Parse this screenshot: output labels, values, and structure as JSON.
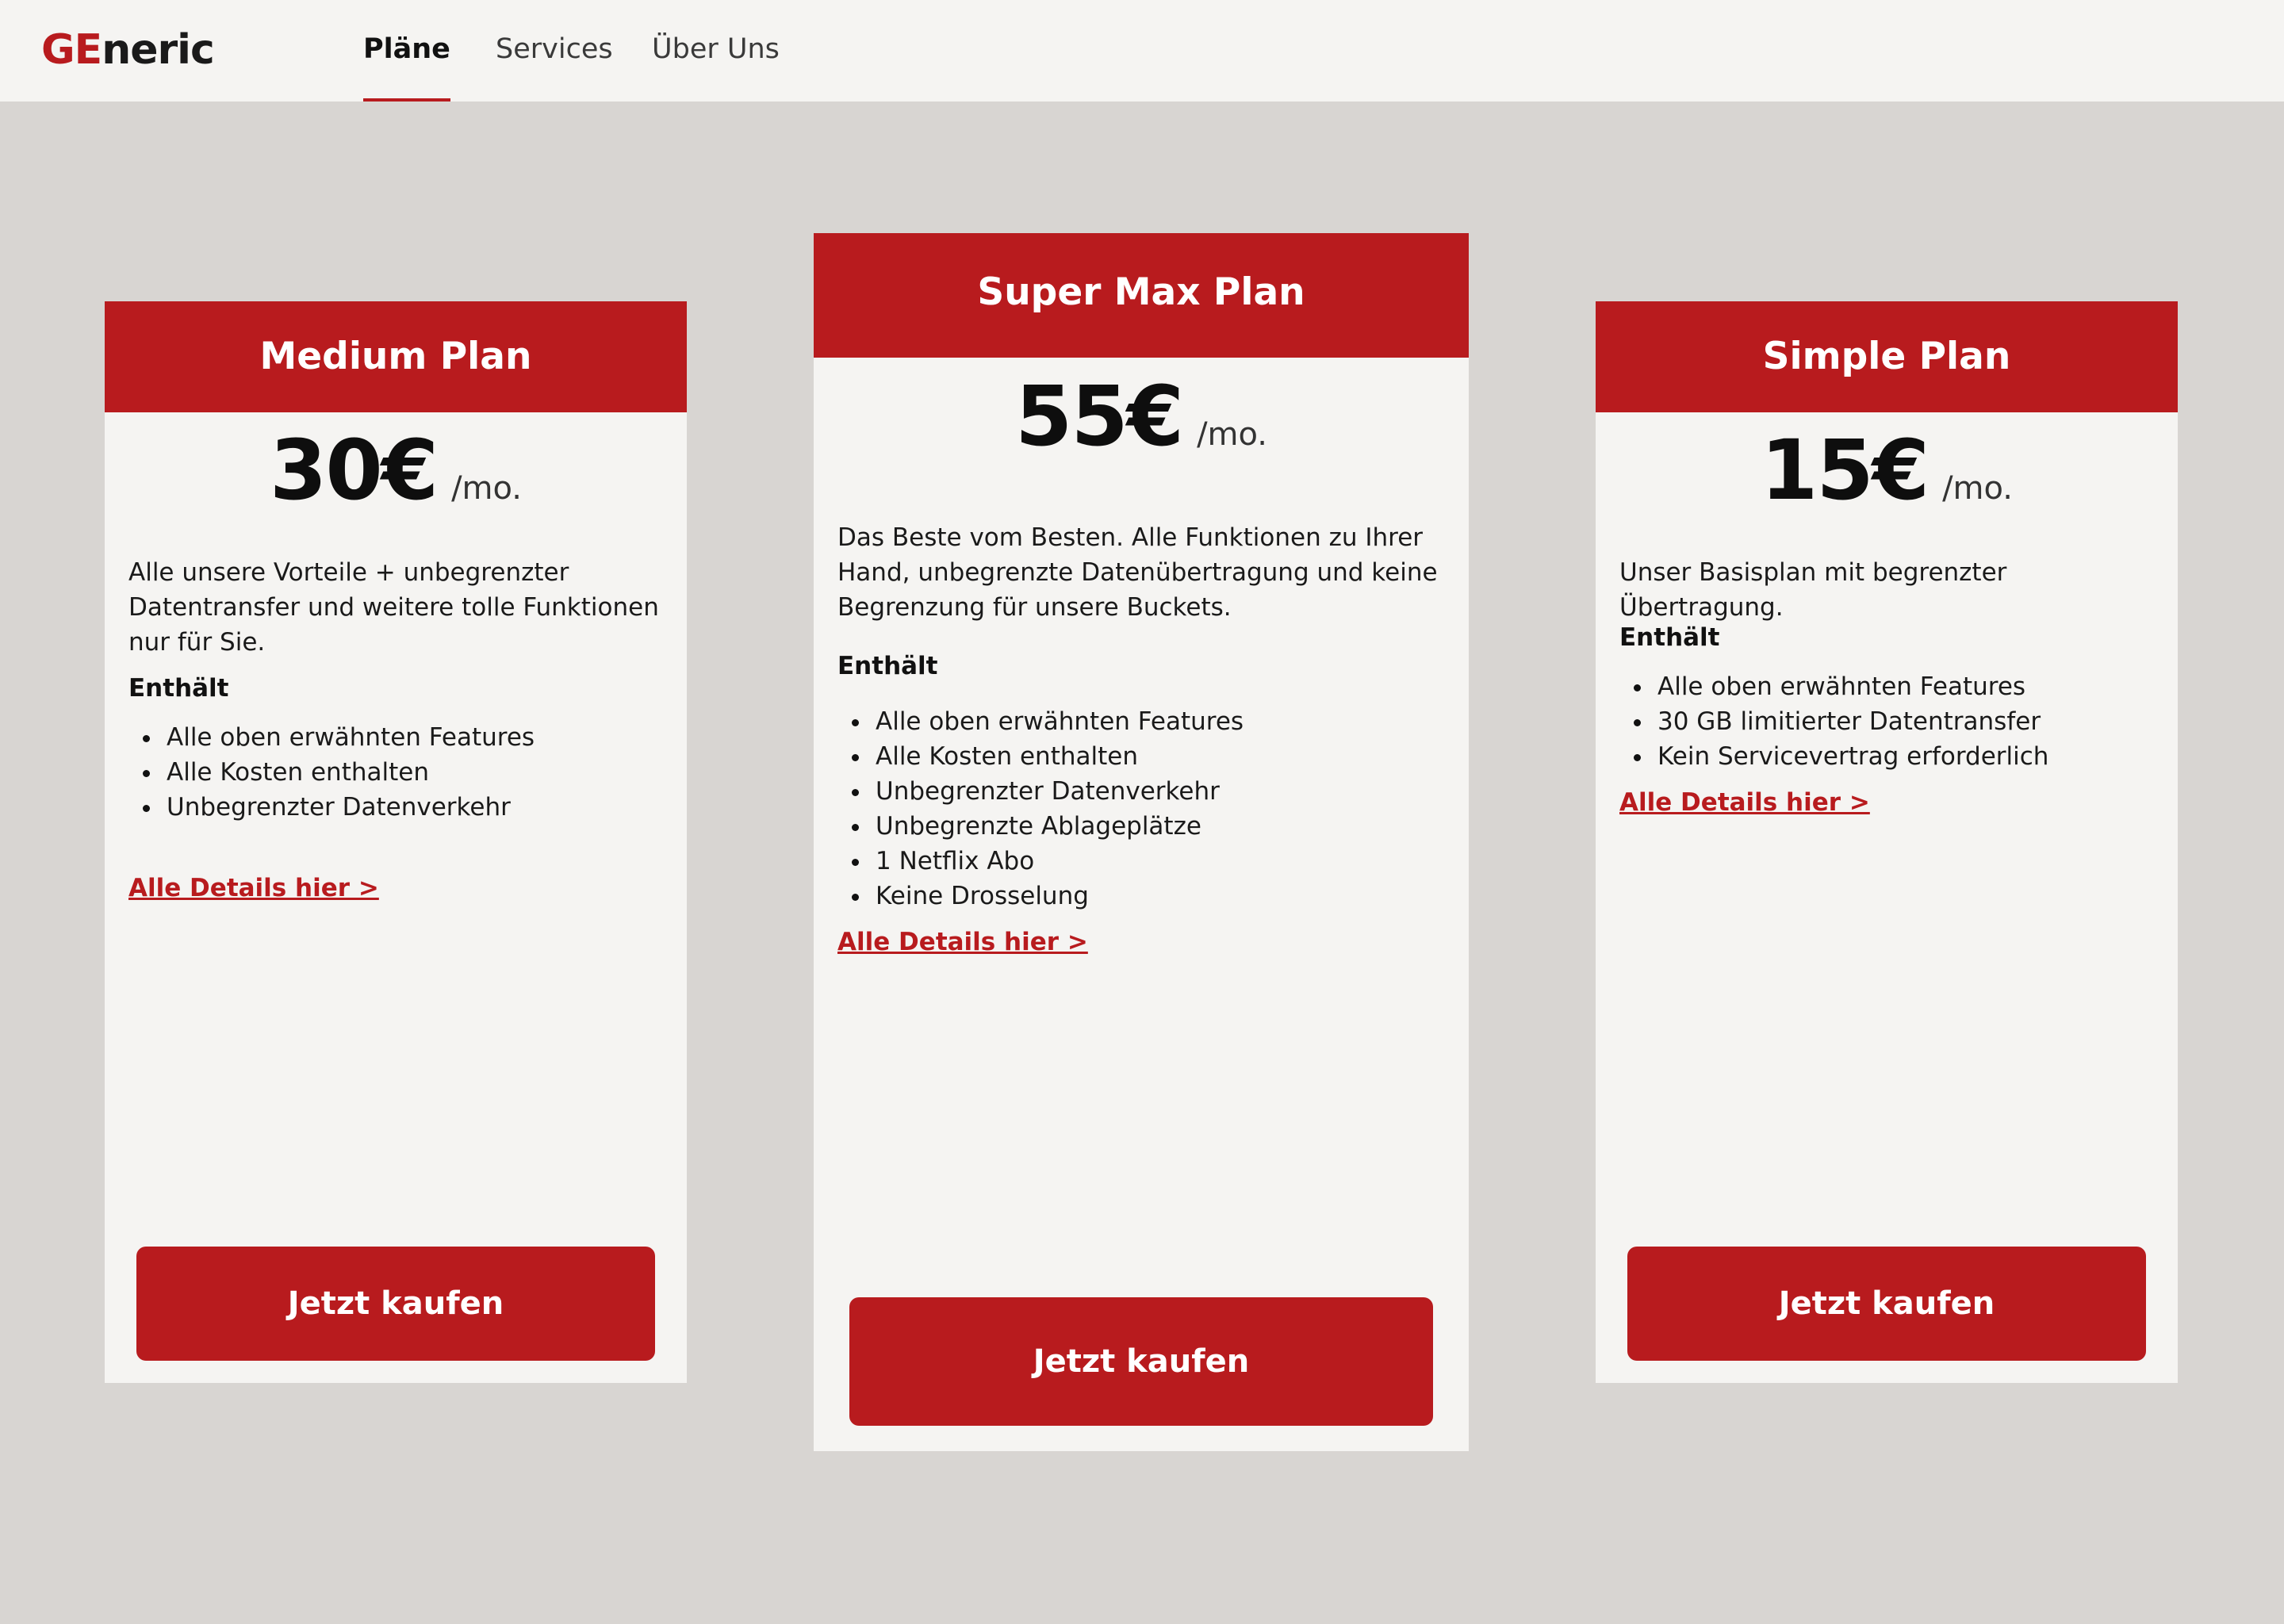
{
  "header": {
    "logo": {
      "accent": "GE",
      "rest": "neric"
    },
    "nav": [
      {
        "label": "Pläne",
        "active": true
      },
      {
        "label": "Services",
        "active": false
      },
      {
        "label": "Über Uns",
        "active": false
      }
    ]
  },
  "colors": {
    "brand": "#b81b1e",
    "page_background": "#d8d5d2",
    "card_background": "#f5f4f2"
  },
  "plans": [
    {
      "name": "Medium Plan",
      "price": "30€",
      "period": "/mo.",
      "description": "Alle unsere Vorteile + unbegrenzter Datentransfer und weitere tolle Funktionen nur für Sie.",
      "includes_label": "Enthält",
      "features": [
        "Alle oben erwähnten Features",
        "Alle Kosten enthalten",
        "Unbegrenzter Datenverkehr"
      ],
      "details_link": "Alle Details hier >",
      "cta": "Jetzt kaufen"
    },
    {
      "name": "Super Max Plan",
      "price": "55€",
      "period": "/mo.",
      "description": "Das Beste vom Besten. Alle Funktionen zu Ihrer Hand, unbegrenzte Datenübertragung und keine Begrenzung für unsere Buckets.",
      "includes_label": "Enthält",
      "features": [
        "Alle oben erwähnten Features",
        "Alle Kosten enthalten",
        "Unbegrenzter Datenverkehr",
        "Unbegrenzte Ablageplätze",
        "1 Netflix Abo",
        "Keine Drosselung"
      ],
      "details_link": "Alle Details hier >",
      "cta": "Jetzt kaufen"
    },
    {
      "name": "Simple Plan",
      "price": "15€",
      "period": "/mo.",
      "description": "Unser Basisplan mit begrenzter Übertragung.",
      "includes_label": "Enthält",
      "features": [
        "Alle oben erwähnten Features",
        "30 GB limitierter Datentransfer",
        "Kein Servicevertrag erforderlich"
      ],
      "details_link": "Alle Details hier >",
      "cta": "Jetzt kaufen"
    }
  ]
}
